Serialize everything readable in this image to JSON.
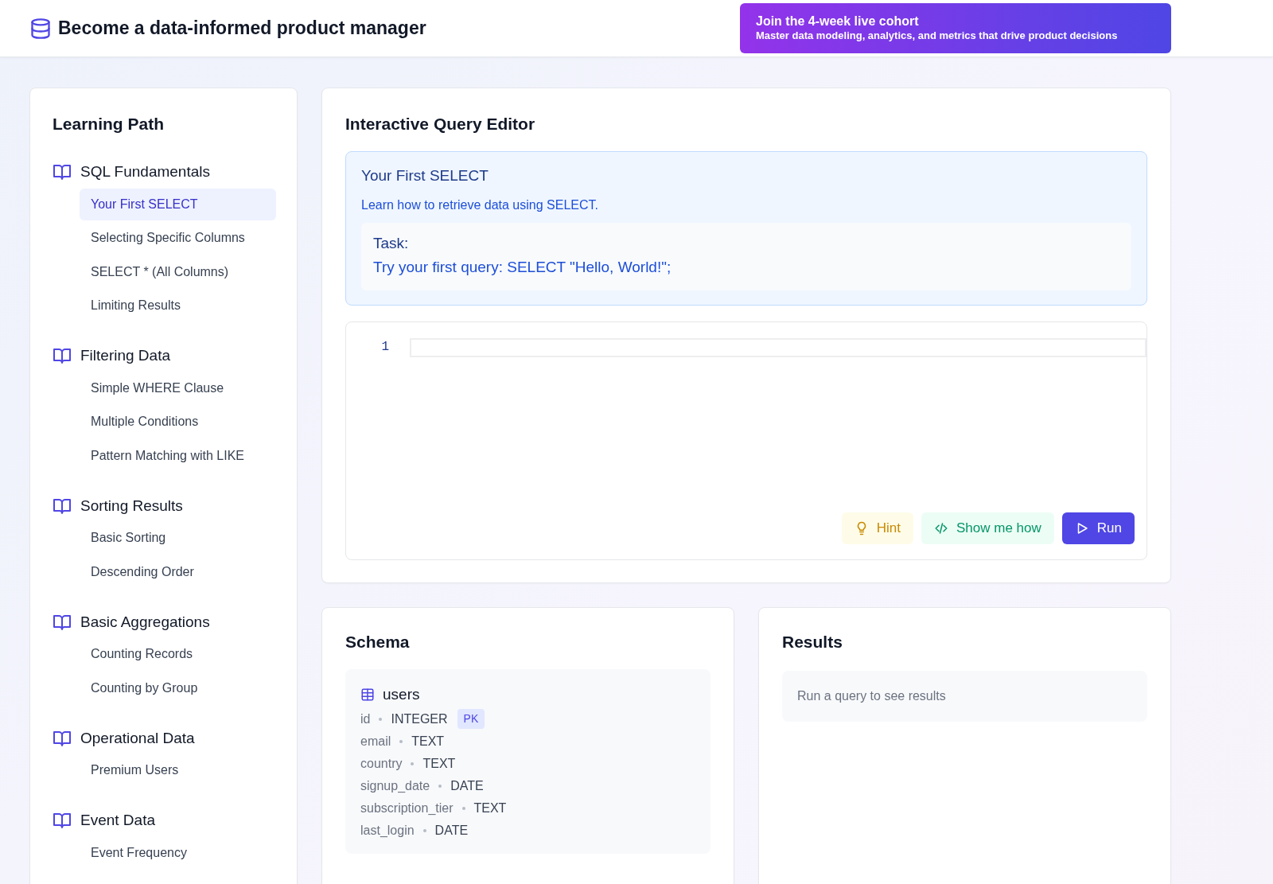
{
  "header": {
    "title": "Become a data-informed product manager",
    "promo": {
      "title": "Join the 4-week live cohort",
      "subtitle": "Master data modeling, analytics, and metrics that drive product decisions"
    }
  },
  "sidebar": {
    "title": "Learning Path",
    "sections": [
      {
        "title": "SQL Fundamentals",
        "items": [
          {
            "label": "Your First SELECT",
            "selected": true
          },
          {
            "label": "Selecting Specific Columns",
            "selected": false
          },
          {
            "label": "SELECT * (All Columns)",
            "selected": false
          },
          {
            "label": "Limiting Results",
            "selected": false
          }
        ]
      },
      {
        "title": "Filtering Data",
        "items": [
          {
            "label": "Simple WHERE Clause",
            "selected": false
          },
          {
            "label": "Multiple Conditions",
            "selected": false
          },
          {
            "label": "Pattern Matching with LIKE",
            "selected": false
          }
        ]
      },
      {
        "title": "Sorting Results",
        "items": [
          {
            "label": "Basic Sorting",
            "selected": false
          },
          {
            "label": "Descending Order",
            "selected": false
          }
        ]
      },
      {
        "title": "Basic Aggregations",
        "items": [
          {
            "label": "Counting Records",
            "selected": false
          },
          {
            "label": "Counting by Group",
            "selected": false
          }
        ]
      },
      {
        "title": "Operational Data",
        "items": [
          {
            "label": "Premium Users",
            "selected": false
          }
        ]
      },
      {
        "title": "Event Data",
        "items": [
          {
            "label": "Event Frequency",
            "selected": false
          }
        ]
      }
    ]
  },
  "editor": {
    "title": "Interactive Query Editor",
    "lesson": {
      "title": "Your First SELECT",
      "description": "Learn how to retrieve data using SELECT.",
      "task_label": "Task:",
      "task": "Try your first query: SELECT \"Hello, World!\";"
    },
    "line_numbers": [
      "1"
    ],
    "buttons": [
      {
        "kind": "hint",
        "label": "Hint"
      },
      {
        "kind": "show",
        "label": "Show me how"
      },
      {
        "kind": "run",
        "label": "Run"
      }
    ]
  },
  "schema": {
    "title": "Schema",
    "tables": [
      {
        "name": "users",
        "columns": [
          {
            "name": "id",
            "type": "INTEGER",
            "badge": "PK"
          },
          {
            "name": "email",
            "type": "TEXT"
          },
          {
            "name": "country",
            "type": "TEXT"
          },
          {
            "name": "signup_date",
            "type": "DATE"
          },
          {
            "name": "subscription_tier",
            "type": "TEXT"
          },
          {
            "name": "last_login",
            "type": "DATE"
          }
        ]
      }
    ]
  },
  "results": {
    "title": "Results",
    "placeholder": "Run a query to see results"
  }
}
